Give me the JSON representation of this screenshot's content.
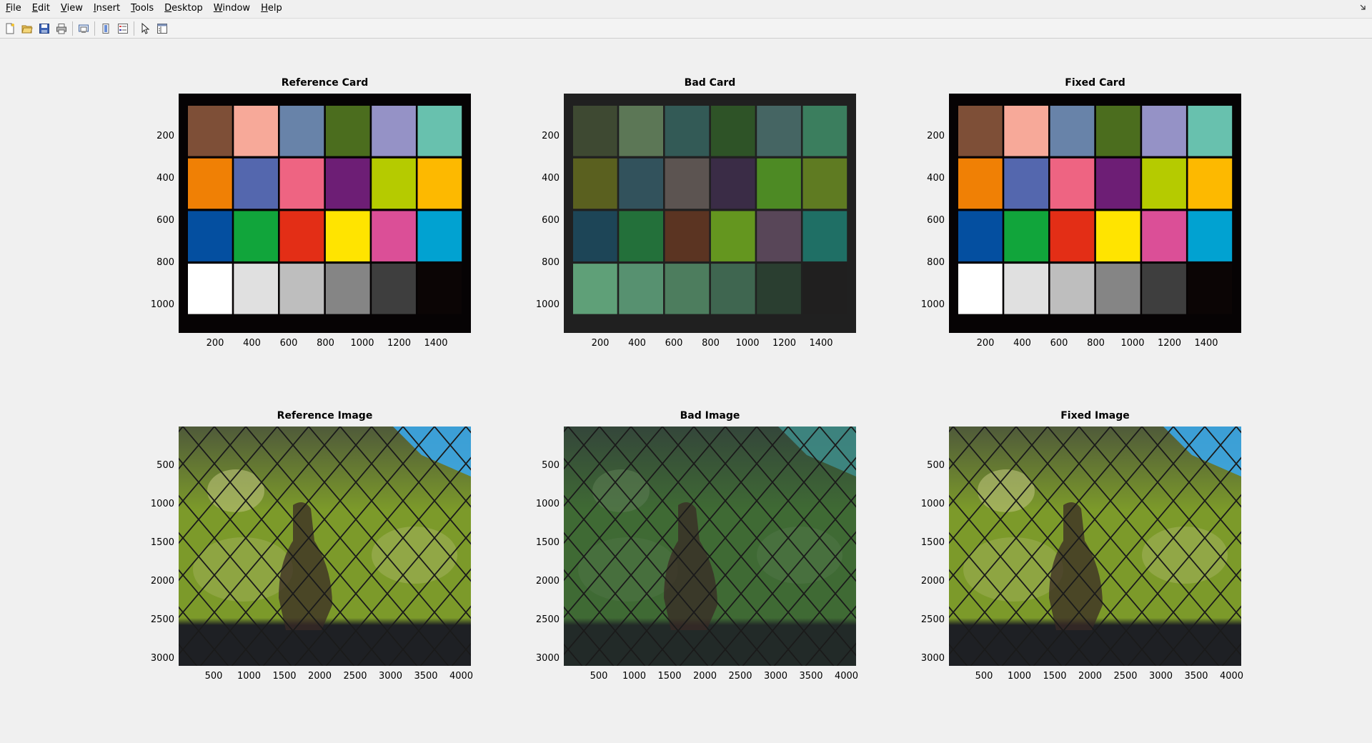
{
  "menu": [
    "File",
    "Edit",
    "View",
    "Insert",
    "Tools",
    "Desktop",
    "Window",
    "Help"
  ],
  "menu_mnemonics": [
    "F",
    "E",
    "V",
    "I",
    "T",
    "D",
    "W",
    "H"
  ],
  "toolbar": {
    "buttons": [
      "new-figure-icon",
      "open-file-icon",
      "save-icon",
      "print-icon",
      "print-preview-icon",
      "colorbar-icon",
      "legend-icon",
      "pointer-icon",
      "property-inspector-icon"
    ]
  },
  "axes": [
    {
      "id": "ref-card",
      "title": "Reference Card",
      "kind": "card",
      "palette": "reference",
      "yticks": [
        "200",
        "400",
        "600",
        "800",
        "1000"
      ],
      "xticks": [
        "200",
        "400",
        "600",
        "800",
        "1000",
        "1200",
        "1400"
      ]
    },
    {
      "id": "bad-card",
      "title": "Bad Card",
      "kind": "card",
      "palette": "bad",
      "yticks": [
        "200",
        "400",
        "600",
        "800",
        "1000"
      ],
      "xticks": [
        "200",
        "400",
        "600",
        "800",
        "1000",
        "1200",
        "1400"
      ]
    },
    {
      "id": "fixed-card",
      "title": "Fixed Card",
      "kind": "card",
      "palette": "reference",
      "yticks": [
        "200",
        "400",
        "600",
        "800",
        "1000"
      ],
      "xticks": [
        "200",
        "400",
        "600",
        "800",
        "1000",
        "1200",
        "1400"
      ]
    },
    {
      "id": "ref-image",
      "title": "Reference Image",
      "kind": "photo",
      "tint": "reference",
      "yticks": [
        "500",
        "1000",
        "1500",
        "2000",
        "2500",
        "3000"
      ],
      "xticks": [
        "500",
        "1000",
        "1500",
        "2000",
        "2500",
        "3000",
        "3500",
        "4000"
      ]
    },
    {
      "id": "bad-image",
      "title": "Bad Image",
      "kind": "photo",
      "tint": "bad",
      "yticks": [
        "500",
        "1000",
        "1500",
        "2000",
        "2500",
        "3000"
      ],
      "xticks": [
        "500",
        "1000",
        "1500",
        "2000",
        "2500",
        "3000",
        "3500",
        "4000"
      ]
    },
    {
      "id": "fixed-image",
      "title": "Fixed Image",
      "kind": "photo",
      "tint": "reference",
      "yticks": [
        "500",
        "1000",
        "1500",
        "2000",
        "2500",
        "3000"
      ],
      "xticks": [
        "500",
        "1000",
        "1500",
        "2000",
        "2500",
        "3000",
        "3500",
        "4000"
      ]
    }
  ],
  "palettes": {
    "reference": [
      "#7e4f37",
      "#f7a999",
      "#6883a9",
      "#4b6d1e",
      "#9592c6",
      "#68c1ae",
      "#f08005",
      "#5467ae",
      "#ee6482",
      "#6d1e75",
      "#b5cb00",
      "#fdb900",
      "#044fa0",
      "#11a53b",
      "#e32e16",
      "#ffe400",
      "#db4f97",
      "#01a2d1",
      "#ffffff",
      "#e0e0e0",
      "#bebebe",
      "#858585",
      "#3e3e3e",
      "#0b0505"
    ],
    "bad": [
      "#3e4932",
      "#5c7756",
      "#335a56",
      "#2e5327",
      "#456563",
      "#3b7e5e",
      "#5a601f",
      "#32525c",
      "#5c5451",
      "#3a2c46",
      "#4d8a24",
      "#5f7b22",
      "#1d4557",
      "#23703a",
      "#5b3422",
      "#64961f",
      "#584658",
      "#1f6f65",
      "#5fa078",
      "#579170",
      "#4d7d5e",
      "#3f6650",
      "#2a3e30",
      "#201f1f"
    ]
  },
  "card_bg": {
    "reference": "#060304",
    "bad": "#202020"
  },
  "tints": {
    "reference": {
      "sky": "#3aa6e8",
      "foliage": "#7c9a2a",
      "ground": "#1e2024",
      "mid": "#4f5a3a",
      "light": "#b9c07a"
    },
    "bad": {
      "sky": "#3e8a86",
      "foliage": "#3f6a34",
      "ground": "#222a28",
      "mid": "#34463a",
      "light": "#5a7a52"
    }
  }
}
